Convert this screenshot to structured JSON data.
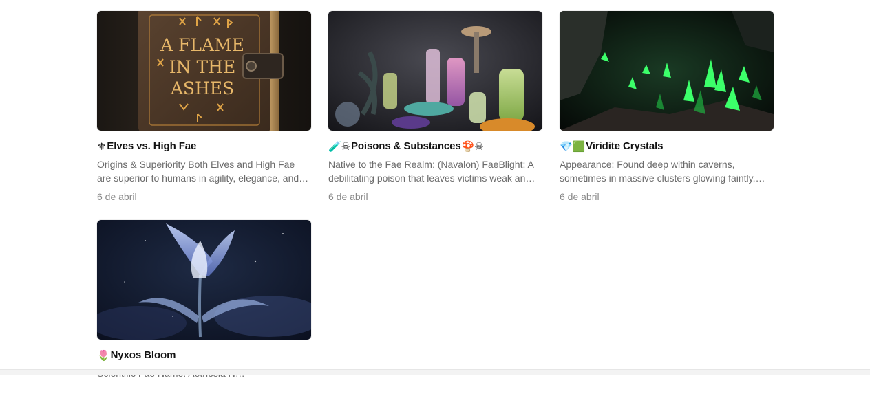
{
  "cards": [
    {
      "title": "Elves vs. High Fae",
      "emoji_before": "⚜",
      "emoji_after": "",
      "description": "Origins & Superiority Both Elves and High Fae are superior to humans in agility, elegance, and bat…",
      "date": "6 de abril",
      "image": {
        "book_title_lines": [
          "A FLAME",
          "IN THE",
          "ASHES"
        ]
      }
    },
    {
      "title": "Poisons & Substances",
      "emoji_before": "🧪☠",
      "emoji_after": "🍄☠",
      "description": "Native to the Fae Realm: (Navalon) FaeBlight: A debilitating poison that leaves victims weak an…",
      "date": "6 de abril"
    },
    {
      "title": "Viridite Crystals",
      "emoji_before": "💎🟩",
      "emoji_after": "",
      "description": "Appearance: Found deep within caverns, sometimes in massive clusters glowing faintly,…",
      "date": "6 de abril"
    },
    {
      "title": "Nyxos Bloom",
      "emoji_before": "🌷",
      "emoji_after": "",
      "description": "Scientific Fae Name: Aethosia N…",
      "date": ""
    }
  ]
}
